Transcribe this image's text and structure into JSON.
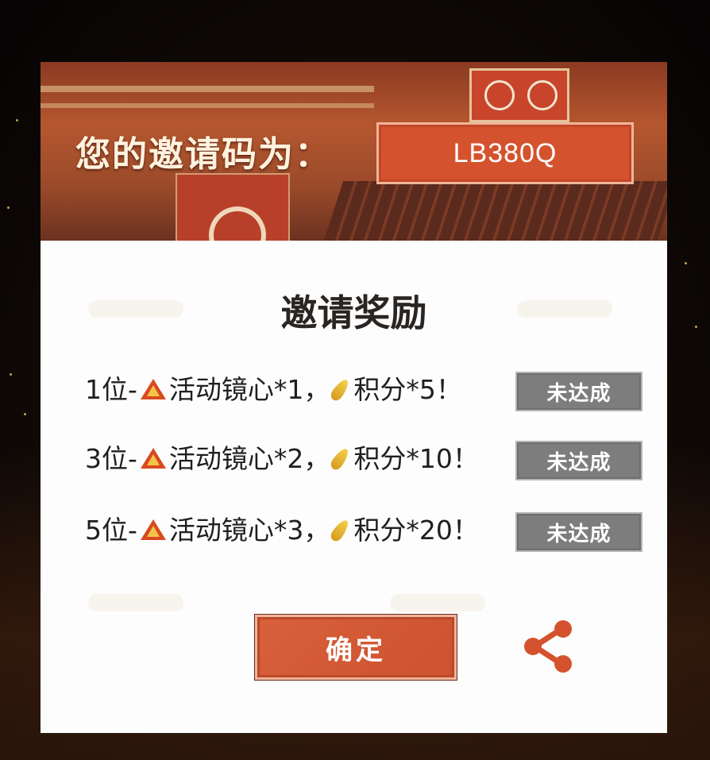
{
  "invite": {
    "label": "您的邀请码为：",
    "code": "LB380Q"
  },
  "rewards": {
    "title": "邀请奖励",
    "items": [
      {
        "rank": "1位-",
        "item1": "活动镜心*1，",
        "item2": "积分*5！",
        "status": "未达成"
      },
      {
        "rank": "3位-",
        "item1": "活动镜心*2，",
        "item2": "积分*10！",
        "status": "未达成"
      },
      {
        "rank": "5位-",
        "item1": "活动镜心*3，",
        "item2": "积分*20！",
        "status": "未达成"
      }
    ],
    "icons": {
      "item1": "mirror-heart-icon",
      "item2": "feather-points-icon"
    }
  },
  "actions": {
    "confirm_label": "确定",
    "share_icon": "share-icon"
  },
  "colors": {
    "accent": "#d4532e",
    "status_gray": "#7d7d7d",
    "title_text": "#2a2522",
    "panel_bg": "#fdfdfd"
  }
}
